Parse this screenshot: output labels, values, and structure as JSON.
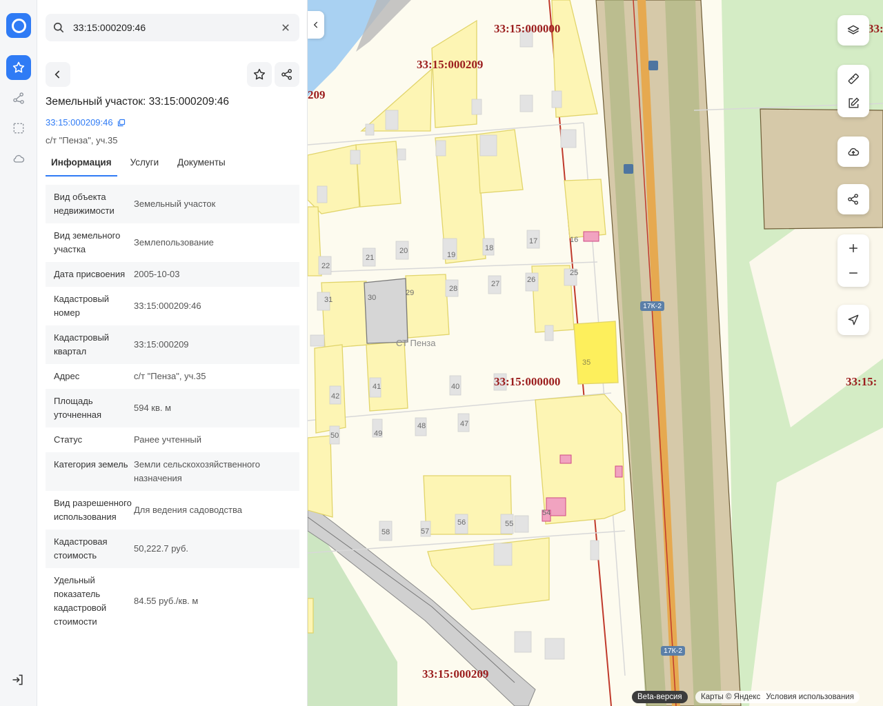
{
  "search": {
    "value": "33:15:000209:46"
  },
  "card": {
    "title": "Земельный участок: 33:15:000209:46",
    "cad_link": "33:15:000209:46",
    "address": "с/т \"Пенза\", уч.35"
  },
  "tabs": [
    "Информация",
    "Услуги",
    "Документы"
  ],
  "props": [
    {
      "k": "Вид объекта недвижимости",
      "v": "Земельный участок"
    },
    {
      "k": "Вид земельного участка",
      "v": "Землепользование"
    },
    {
      "k": "Дата присвоения",
      "v": "2005-10-03"
    },
    {
      "k": "Кадастровый номер",
      "v": "33:15:000209:46"
    },
    {
      "k": "Кадастровый квартал",
      "v": "33:15:000209"
    },
    {
      "k": "Адрес",
      "v": "с/т \"Пенза\", уч.35"
    },
    {
      "k": "Площадь уточненная",
      "v": "594 кв. м"
    },
    {
      "k": "Статус",
      "v": "Ранее учтенный"
    },
    {
      "k": "Категория земель",
      "v": "Земли сельскохозяйственного назначения"
    },
    {
      "k": "Вид разрешенного использования",
      "v": "Для ведения садоводства"
    },
    {
      "k": "Кадастровая стоимость",
      "v": "50,222.7 руб."
    },
    {
      "k": "Удельный показатель кадастровой стоимости",
      "v": "84.55 руб./кв. м"
    }
  ],
  "map": {
    "quarter_labels": [
      "33:15:000000",
      "33:15:000209",
      "209",
      "33:15:000000",
      "33:15:000209",
      "33:15:",
      "33:15:"
    ],
    "lot_numbers": [
      "22",
      "21",
      "20",
      "19",
      "18",
      "17",
      "16",
      "31",
      "30",
      "29",
      "28",
      "27",
      "26",
      "25",
      "35",
      "42",
      "41",
      "40",
      "50",
      "49",
      "48",
      "47",
      "58",
      "57",
      "56",
      "55",
      "54"
    ],
    "place_name": "СТ Пенза",
    "road_badge": "17К-2",
    "beta": "Beta-версия",
    "credits": [
      "Карты © Яндекс",
      "Условия использования"
    ]
  },
  "colors": {
    "accent": "#2f7bf5",
    "parcel_fill": "#fdf5b4",
    "parcel_stroke": "#e1d46a",
    "selected_parcel": "#fdef5c",
    "quarter_label": "#9b1d1d",
    "road_band": "#d6c9a9"
  }
}
